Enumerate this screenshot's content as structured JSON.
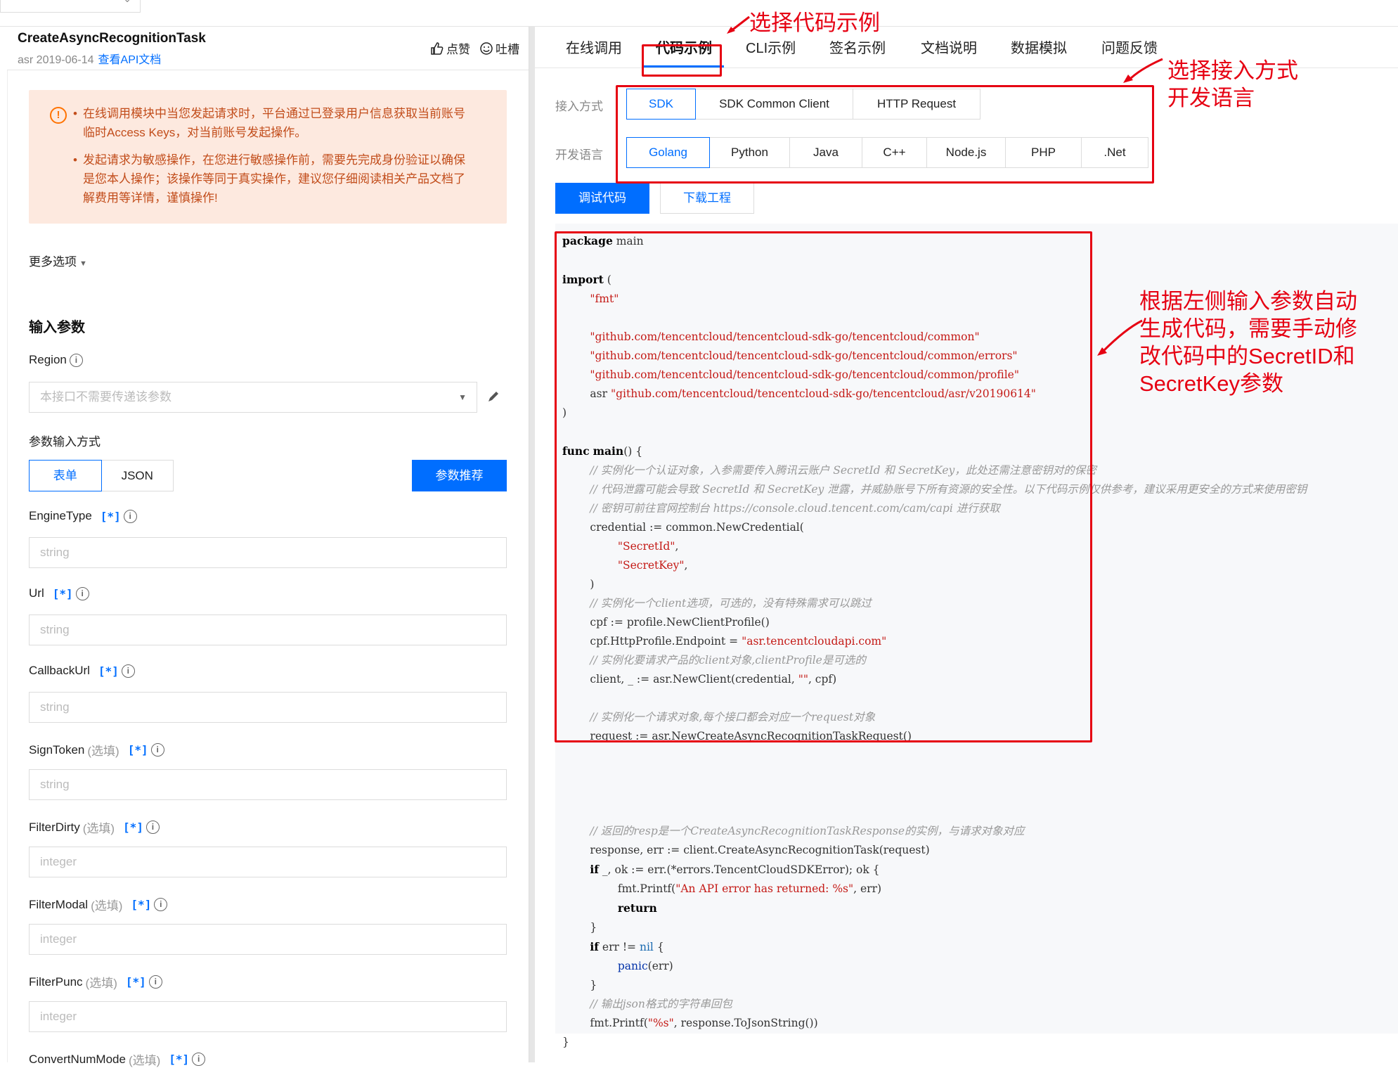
{
  "header": {
    "api_name": "CreateAsyncRecognitionTask",
    "meta": "asr 2019-06-14",
    "doc_link": "查看API文档",
    "like": "点赞",
    "tucao": "吐槽"
  },
  "warning": {
    "items": [
      "在线调用模块中当您发起请求时，平台通过已登录用户信息获取当前账号临时Access Keys，对当前账号发起操作。",
      "发起请求为敏感操作，在您进行敏感操作前，需要先完成身份验证以确保是您本人操作；该操作等同于真实操作，建议您仔细阅读相关产品文档了解费用等详情，谨慎操作!"
    ]
  },
  "more_options": "更多选项",
  "input_params": {
    "title": "输入参数",
    "region_label": "Region",
    "region_placeholder": "本接口不需要传递该参数",
    "mode_label": "参数输入方式",
    "mode_form": "表单",
    "mode_json": "JSON",
    "recommend_button": "参数推荐",
    "optional_tag": "(选填)",
    "star": "[*]",
    "fields": [
      {
        "name": "EngineType",
        "optional": false,
        "placeholder": "string"
      },
      {
        "name": "Url",
        "optional": false,
        "placeholder": "string"
      },
      {
        "name": "CallbackUrl",
        "optional": false,
        "placeholder": "string"
      },
      {
        "name": "SignToken",
        "optional": true,
        "placeholder": "string"
      },
      {
        "name": "FilterDirty",
        "optional": true,
        "placeholder": "integer"
      },
      {
        "name": "FilterModal",
        "optional": true,
        "placeholder": "integer"
      },
      {
        "name": "FilterPunc",
        "optional": true,
        "placeholder": "integer"
      },
      {
        "name": "ConvertNumMode",
        "optional": true,
        "placeholder": ""
      }
    ]
  },
  "nav": {
    "tabs": [
      "在线调用",
      "代码示例",
      "CLI示例",
      "签名示例",
      "文档说明",
      "数据模拟",
      "问题反馈"
    ],
    "active": "代码示例"
  },
  "access": {
    "label": "接入方式",
    "options": [
      "SDK",
      "SDK Common Client",
      "HTTP Request"
    ],
    "selected": "SDK"
  },
  "language": {
    "label": "开发语言",
    "options": [
      "Golang",
      "Python",
      "Java",
      "C++",
      "Node.js",
      "PHP",
      ".Net"
    ],
    "selected": "Golang"
  },
  "buttons": {
    "debug": "调试代码",
    "download": "下载工程"
  },
  "annotations": {
    "select_example": "选择代码示例",
    "select_access": "选择接入方式\n开发语言",
    "auto_code": "根据左侧输入参数自动\n生成代码，需要手动修\n改代码中的SecretID和\nSecretKey参数"
  },
  "code_lines": [
    {
      "t": [
        [
          "kw",
          "package"
        ],
        [
          "",
          " main"
        ]
      ]
    },
    {
      "t": []
    },
    {
      "t": [
        [
          "kw",
          "import"
        ],
        [
          "",
          " ("
        ]
      ]
    },
    {
      "t": [
        [
          "",
          "        "
        ],
        [
          "st",
          "\"fmt\""
        ]
      ]
    },
    {
      "t": []
    },
    {
      "t": [
        [
          "",
          "        "
        ],
        [
          "st",
          "\"github.com/tencentcloud/tencentcloud-sdk-go/tencentcloud/common\""
        ]
      ]
    },
    {
      "t": [
        [
          "",
          "        "
        ],
        [
          "st",
          "\"github.com/tencentcloud/tencentcloud-sdk-go/tencentcloud/common/errors\""
        ]
      ]
    },
    {
      "t": [
        [
          "",
          "        "
        ],
        [
          "st",
          "\"github.com/tencentcloud/tencentcloud-sdk-go/tencentcloud/common/profile\""
        ]
      ]
    },
    {
      "t": [
        [
          "",
          "        asr "
        ],
        [
          "st",
          "\"github.com/tencentcloud/tencentcloud-sdk-go/tencentcloud/asr/v20190614\""
        ]
      ]
    },
    {
      "t": [
        [
          "",
          ")"
        ]
      ]
    },
    {
      "t": []
    },
    {
      "t": [
        [
          "kw",
          "func"
        ],
        [
          "",
          " "
        ],
        [
          "kw",
          "main"
        ],
        [
          "",
          "() {"
        ]
      ]
    },
    {
      "t": [
        [
          "",
          "        "
        ],
        [
          "cm",
          "// 实例化一个认证对象，入参需要传入腾讯云账户 SecretId 和 SecretKey，此处还需注意密钥对的保密"
        ]
      ]
    },
    {
      "t": [
        [
          "",
          "        "
        ],
        [
          "cm",
          "// 代码泄露可能会导致 SecretId 和 SecretKey 泄露，并威胁账号下所有资源的安全性。以下代码示例仅供参考，建议采用更安全的方式来使用密钥"
        ]
      ]
    },
    {
      "t": [
        [
          "",
          "        "
        ],
        [
          "cm",
          "// 密钥可前往官网控制台 https://console.cloud.tencent.com/cam/capi 进行获取"
        ]
      ]
    },
    {
      "t": [
        [
          "",
          "        credential := common.NewCredential("
        ]
      ]
    },
    {
      "t": [
        [
          "",
          "                "
        ],
        [
          "st",
          "\"SecretId\""
        ],
        [
          "",
          ","
        ]
      ]
    },
    {
      "t": [
        [
          "",
          "                "
        ],
        [
          "st",
          "\"SecretKey\""
        ],
        [
          "",
          ","
        ]
      ]
    },
    {
      "t": [
        [
          "",
          "        )"
        ]
      ]
    },
    {
      "t": [
        [
          "",
          "        "
        ],
        [
          "cm",
          "// 实例化一个client选项，可选的，没有特殊需求可以跳过"
        ]
      ]
    },
    {
      "t": [
        [
          "",
          "        cpf := profile.NewClientProfile()"
        ]
      ]
    },
    {
      "t": [
        [
          "",
          "        cpf.HttpProfile.Endpoint = "
        ],
        [
          "st",
          "\"asr.tencentcloudapi.com\""
        ]
      ]
    },
    {
      "t": [
        [
          "",
          "        "
        ],
        [
          "cm",
          "// 实例化要请求产品的client对象,clientProfile是可选的"
        ]
      ]
    },
    {
      "t": [
        [
          "",
          "        client, _ := asr.NewClient(credential, "
        ],
        [
          "st",
          "\"\""
        ],
        [
          "",
          ", cpf)"
        ]
      ]
    },
    {
      "t": []
    },
    {
      "t": [
        [
          "",
          "        "
        ],
        [
          "cm",
          "// 实例化一个请求对象,每个接口都会对应一个request对象"
        ]
      ]
    },
    {
      "t": [
        [
          "",
          "        request := asr.NewCreateAsyncRecognitionTaskRequest()"
        ]
      ]
    },
    {
      "t": []
    },
    {
      "t": []
    },
    {
      "t": []
    },
    {
      "t": []
    },
    {
      "t": [
        [
          "",
          "        "
        ],
        [
          "cm",
          "// 返回的resp是一个CreateAsyncRecognitionTaskResponse的实例，与请求对象对应"
        ]
      ]
    },
    {
      "t": [
        [
          "",
          "        response, err := client.CreateAsyncRecognitionTask(request)"
        ]
      ]
    },
    {
      "t": [
        [
          "",
          "        "
        ],
        [
          "kw",
          "if"
        ],
        [
          "",
          " _, ok := err.(*errors.TencentCloudSDKError); ok {"
        ]
      ]
    },
    {
      "t": [
        [
          "",
          "                fmt.Printf("
        ],
        [
          "st",
          "\"An API error has returned: %s\""
        ],
        [
          "",
          ", err)"
        ]
      ]
    },
    {
      "t": [
        [
          "",
          "                "
        ],
        [
          "kw",
          "return"
        ]
      ]
    },
    {
      "t": [
        [
          "",
          "        }"
        ]
      ]
    },
    {
      "t": [
        [
          "",
          "        "
        ],
        [
          "kw",
          "if"
        ],
        [
          "",
          " err != "
        ],
        [
          "nl",
          "nil"
        ],
        [
          "",
          " {"
        ]
      ]
    },
    {
      "t": [
        [
          "",
          "                "
        ],
        [
          "fn",
          "panic"
        ],
        [
          "",
          "(err)"
        ]
      ]
    },
    {
      "t": [
        [
          "",
          "        }"
        ]
      ]
    },
    {
      "t": [
        [
          "",
          "        "
        ],
        [
          "cm",
          "// 输出json格式的字符串回包"
        ]
      ]
    },
    {
      "t": [
        [
          "",
          "        fmt.Printf("
        ],
        [
          "st",
          "\"%s\""
        ],
        [
          "",
          ", response.ToJsonString())"
        ]
      ]
    },
    {
      "t": [
        [
          "",
          "}"
        ]
      ]
    }
  ]
}
